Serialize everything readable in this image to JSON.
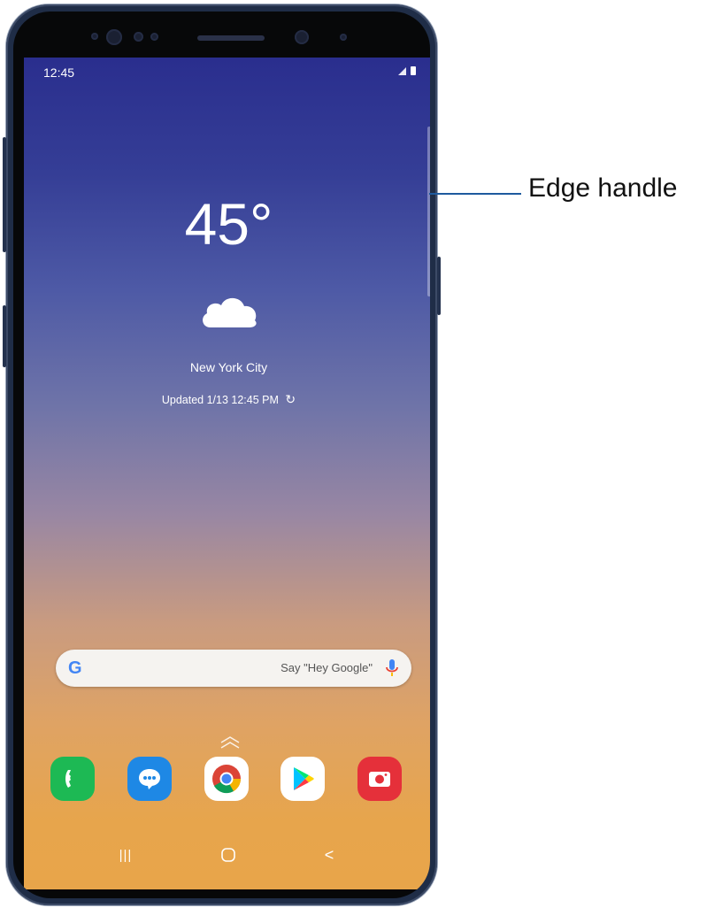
{
  "status_bar": {
    "time": "12:45"
  },
  "weather": {
    "temperature": "45°",
    "city": "New York City",
    "updated": "Updated 1/13 12:45 PM",
    "condition_icon": "cloud-icon"
  },
  "search": {
    "logo": "G",
    "hint": "Say \"Hey Google\"",
    "mic_icon": "mic-icon"
  },
  "dock": {
    "apps": [
      {
        "name": "Phone",
        "icon": "phone-icon",
        "color": "#1db954"
      },
      {
        "name": "Messages",
        "icon": "messages-icon",
        "color": "#1e88e5"
      },
      {
        "name": "Chrome",
        "icon": "chrome-icon",
        "color": "#ffffff"
      },
      {
        "name": "Play Store",
        "icon": "play-store-icon",
        "color": "#ffffff"
      },
      {
        "name": "Camera",
        "icon": "camera-icon",
        "color": "#e5303a"
      }
    ]
  },
  "nav": {
    "recents": "|||",
    "home_icon": "home-icon",
    "back": "<"
  },
  "callout": {
    "label": "Edge handle"
  }
}
